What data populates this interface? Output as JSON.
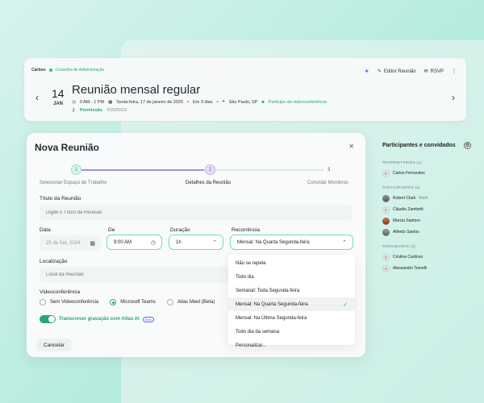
{
  "event": {
    "org": "Carbon",
    "council": "Conselho de Administração",
    "day": "14",
    "month": "JAN",
    "title": "Reunião mensal regular",
    "time": "9 AM - 1 PM",
    "date": "Sexta-feira, 17 de janeiro de 2025",
    "relative": "Em 3 dias",
    "location": "São Paulo, SP",
    "videoconf": "Participe da videoconferência",
    "permission": "Permissão",
    "code": "R2025GS",
    "actions": {
      "editor": "Editor Reunião",
      "rsvp": "RSVP"
    }
  },
  "participants": {
    "title": "Participantes e convidados",
    "sections": [
      {
        "title": "PROPRIETÁRIOS (1)",
        "people": [
          {
            "name": "Carlos Fernandes",
            "initial": "C",
            "you": ""
          }
        ]
      },
      {
        "title": "PARTICIPANTES (5)",
        "people": [
          {
            "name": "Robert Clark",
            "initial": "",
            "you": "Você"
          },
          {
            "name": "Cláudio Zambetti",
            "initial": "C",
            "you": ""
          },
          {
            "name": "Marcia Santoro",
            "initial": "",
            "you": ""
          },
          {
            "name": "Alfredo Santos",
            "initial": "",
            "you": ""
          }
        ]
      },
      {
        "title": "CONVIDADOS (2)",
        "people": [
          {
            "name": "Cristina Cardoso",
            "initial": "C",
            "you": ""
          },
          {
            "name": "Alessandro Tornelli",
            "initial": "A",
            "you": ""
          }
        ]
      }
    ]
  },
  "modal": {
    "title": "Nova Reunião",
    "steps": [
      {
        "num": "1",
        "label": "Selecionar Espaço de Trabalho"
      },
      {
        "num": "2",
        "label": "Detalhes da Reunião"
      },
      {
        "num": "3",
        "label": "Convidar Membros"
      }
    ],
    "title_label": "Título da Reunião",
    "title_placeholder": "Digite o Título da Reunião",
    "date_label": "Data",
    "date_value": "25 de Set, 2024",
    "time_label": "De",
    "time_value": "9:00 AM",
    "duration_label": "Duração",
    "duration_value": "1h",
    "recurrence_label": "Recorrência",
    "recurrence_value": "Mensal: Na Quarta Segunda-feira",
    "location_label": "Localização",
    "location_placeholder": "Local da Reunião",
    "video_label": "Videoconferência",
    "video_options": [
      "Sem Videoconferência",
      "Microsoft Teams",
      "Atlas Meet (Beta)"
    ],
    "transcribe_label": "Transcrever gravação com Atlas AI",
    "beta": "Beta",
    "cancel": "Cancelar"
  },
  "dropdown": {
    "options": [
      "Não se repete",
      "Todo dia",
      "Semanal: Toda Segunda-feira",
      "Mensal: Na Quarta Segunda-feira",
      "Mensal: Na Última Segunda-feira",
      "Todo dia da semana",
      "Personalizar..."
    ],
    "selected_index": 3
  },
  "colors": {
    "accent": "#2aa76f",
    "focus": "#6fdcbc",
    "ai": "#5b6cf0",
    "step_active": "#a98be0"
  }
}
